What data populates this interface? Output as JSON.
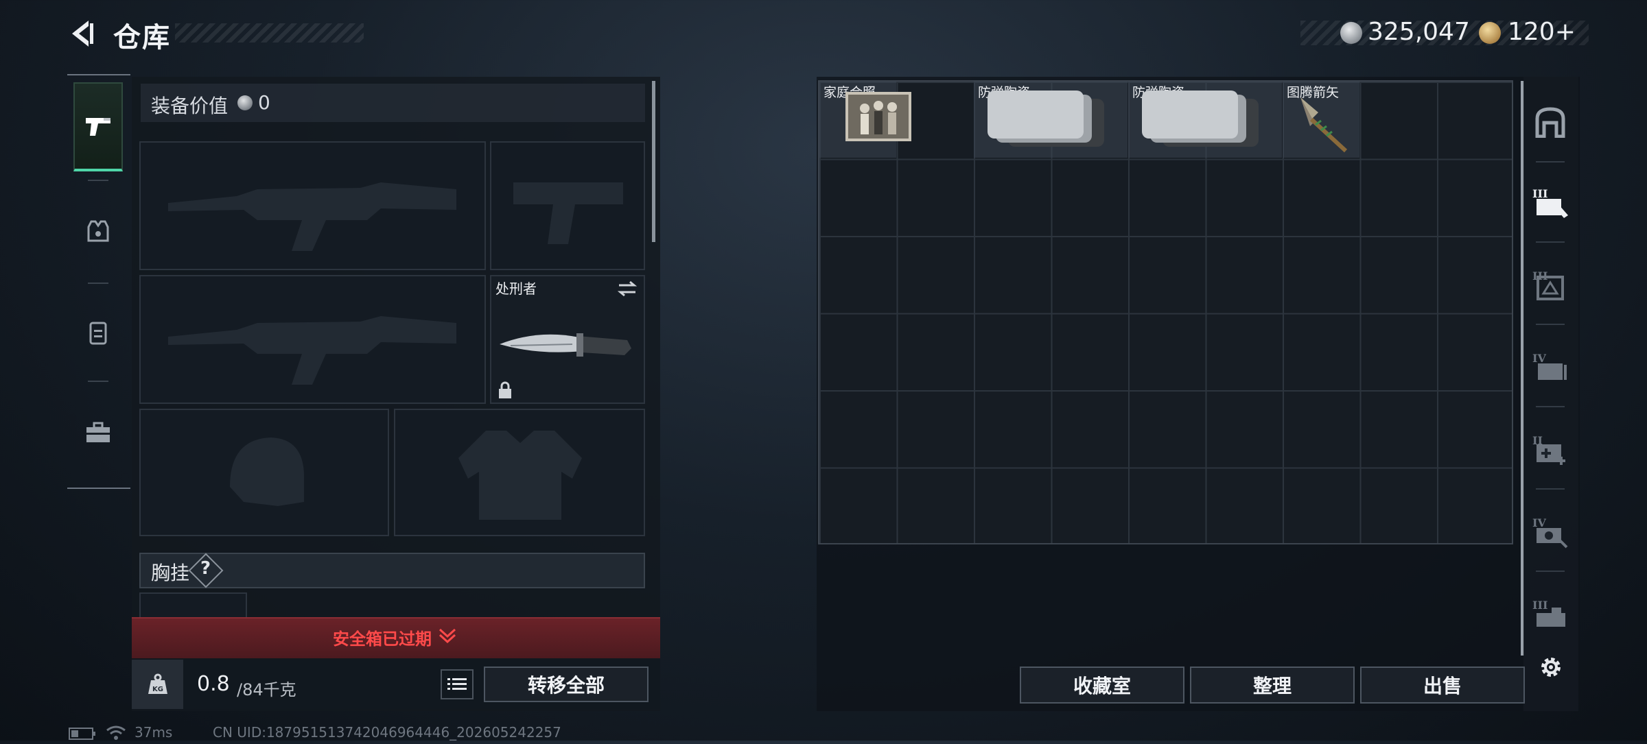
{
  "header": {
    "title": "仓库"
  },
  "currency": {
    "coins": "325,047",
    "premium": "120+"
  },
  "equipment": {
    "value_label": "装备价值",
    "value": "0",
    "melee_name": "处刑者",
    "chest_label": "胸挂",
    "chest_help": "?",
    "safe_box_status": "安全箱已过期",
    "weight_current": "0.8",
    "weight_max": "/84千克",
    "transfer_all": "转移全部"
  },
  "storage": {
    "items": [
      {
        "label": "家庭合照"
      },
      {
        "label": "防弹陶瓷"
      },
      {
        "label": "防弹陶瓷"
      },
      {
        "label": "图腾箭矢"
      }
    ],
    "buttons": {
      "collection": "收藏室",
      "sort": "整理",
      "sell": "出售"
    }
  },
  "status": {
    "ping": "37ms",
    "uid": "CN UID:18795151374204696444​6_202605242257"
  }
}
